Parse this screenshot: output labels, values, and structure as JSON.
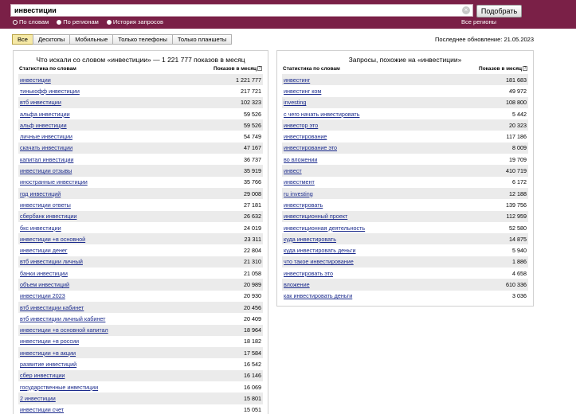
{
  "search": {
    "value": "инвестиции",
    "clear": "×",
    "submit_label": "Подобрать"
  },
  "modes": [
    {
      "label": "По словам",
      "checked": true
    },
    {
      "label": "По регионам",
      "checked": false
    },
    {
      "label": "История запросов",
      "checked": false
    }
  ],
  "region_link": "Все регионы",
  "tabs": [
    "Все",
    "Десктопы",
    "Мобильные",
    "Только телефоны",
    "Только планшеты"
  ],
  "last_update": "Последнее обновление: 21.05.2023",
  "left": {
    "title": "Что искали со словом «инвестиции» — 1 221 777 показов в месяц",
    "col_stat": "Статистика по словам",
    "col_shows": "Показов в месяц",
    "help": "?",
    "rows": [
      [
        "инвестиции",
        "1 221 777"
      ],
      [
        "тинькофф инвестиции",
        "217 721"
      ],
      [
        "втб инвестиции",
        "102 323"
      ],
      [
        "альфа инвестиции",
        "59 526"
      ],
      [
        "альф инвестиции",
        "59 526"
      ],
      [
        "личные инвестиции",
        "54 749"
      ],
      [
        "скачать инвестиции",
        "47 167"
      ],
      [
        "капитал инвестиции",
        "36 737"
      ],
      [
        "инвестиции отзывы",
        "35 919"
      ],
      [
        "иностранные инвестиции",
        "35 766"
      ],
      [
        "год инвестиций",
        "29 008"
      ],
      [
        "инвестиции ответы",
        "27 181"
      ],
      [
        "сбербанк инвестиции",
        "26 632"
      ],
      [
        "бкс инвестиции",
        "24 019"
      ],
      [
        "инвестиции +в основной",
        "23 311"
      ],
      [
        "инвестиции денег",
        "22 804"
      ],
      [
        "втб инвестиции личный",
        "21 310"
      ],
      [
        "банки инвестиции",
        "21 058"
      ],
      [
        "объем инвестиций",
        "20 989"
      ],
      [
        "инвестиции 2023",
        "20 930"
      ],
      [
        "втб инвестиции кабинет",
        "20 456"
      ],
      [
        "втб инвестиции личный кабинет",
        "20 409"
      ],
      [
        "инвестиции +в основной капитал",
        "18 964"
      ],
      [
        "инвестиции +в россии",
        "18 182"
      ],
      [
        "инвестиции +в акции",
        "17 584"
      ],
      [
        "развитие инвестиций",
        "16 542"
      ],
      [
        "сбер инвестиции",
        "16 146"
      ],
      [
        "государственные инвестиции",
        "16 069"
      ],
      [
        "2 инвестиции",
        "15 801"
      ],
      [
        "инвестиции счет",
        "15 051"
      ]
    ]
  },
  "right": {
    "title": "Запросы, похожие на «инвестиции»",
    "col_stat": "Статистика по словам",
    "col_shows": "Показов в месяц",
    "help": "?",
    "rows": [
      [
        "инвестинг",
        "181 683"
      ],
      [
        "инвестинг ком",
        "49 972"
      ],
      [
        "investing",
        "108 800"
      ],
      [
        "с чего начать инвестировать",
        "5 442"
      ],
      [
        "инвестор это",
        "20 323"
      ],
      [
        "инвестирование",
        "117 186"
      ],
      [
        "инвестирование это",
        "8 009"
      ],
      [
        "во вложении",
        "19 709"
      ],
      [
        "инвест",
        "410 719"
      ],
      [
        "инвестмент",
        "6 172"
      ],
      [
        "ru investing",
        "12 188"
      ],
      [
        "инвестировать",
        "139 756"
      ],
      [
        "инвестиционный проект",
        "112 959"
      ],
      [
        "инвестиционная деятельность",
        "52 580"
      ],
      [
        "куда инвестировать",
        "14 875"
      ],
      [
        "куда инвестировать деньги",
        "5 940"
      ],
      [
        "что такое инвестирование",
        "1 886"
      ],
      [
        "инвестировать это",
        "4 658"
      ],
      [
        "вложение",
        "610 336"
      ],
      [
        "как инвестировать деньги",
        "3 036"
      ]
    ]
  }
}
